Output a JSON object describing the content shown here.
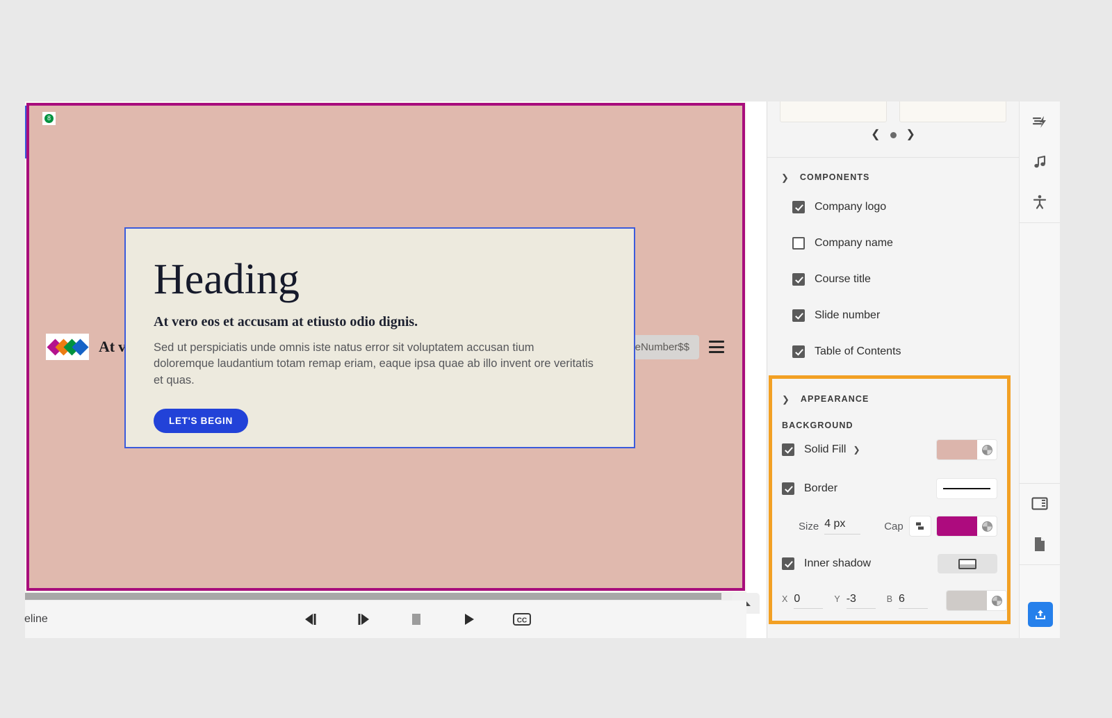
{
  "slide": {
    "header": {
      "logo_icon": "company-logo-diamonds",
      "logo_inner_label": "8",
      "course_title": "At vero eos et accusamus et iusto.",
      "slide_number_variable": "$$Project.CurrentSlideNumber$$",
      "toc_icon": "hamburger-menu-icon",
      "background_color": "#e0b9ae",
      "border_color": "#a80d7c"
    },
    "text_block": {
      "heading": "Heading",
      "subheading": "At vero eos et accusam at etiusto odio dignis.",
      "body": "Sed ut perspiciatis unde omnis iste natus error sit voluptatem accusan tium doloremque laudantium totam remap eriam, eaque ipsa quae ab illo invent ore veritatis et quas.",
      "cta_label": "LET'S BEGIN",
      "cta_color": "#2242d8",
      "background_color": "#edeade"
    }
  },
  "timeline": {
    "label": "eline",
    "controls": [
      {
        "name": "step-backward-button",
        "glyph": "prev"
      },
      {
        "name": "step-forward-button",
        "glyph": "next"
      },
      {
        "name": "stop-button",
        "glyph": "stop"
      },
      {
        "name": "play-button",
        "glyph": "play"
      },
      {
        "name": "closed-captions-button",
        "glyph": "cc",
        "label": "CC"
      }
    ],
    "collapse_icon": "chevron-up-icon"
  },
  "properties_panel": {
    "carousel": {
      "prev_icon": "chevron-left-icon",
      "next_icon": "chevron-right-icon",
      "dot_icon": "carousel-dot"
    },
    "components": {
      "title": "COMPONENTS",
      "collapse_icon": "chevron-down-icon",
      "items": [
        {
          "label": "Company logo",
          "checked": true
        },
        {
          "label": "Company name",
          "checked": false
        },
        {
          "label": "Course title",
          "checked": true
        },
        {
          "label": "Slide number",
          "checked": true
        },
        {
          "label": "Table of Contents",
          "checked": true
        }
      ]
    },
    "appearance": {
      "title": "APPEARANCE",
      "collapse_icon": "chevron-down-icon",
      "highlight_color": "#f2a024",
      "background_group_label": "BACKGROUND",
      "solid_fill": {
        "label": "Solid Fill",
        "checked": true,
        "dropdown_icon": "chevron-down-icon",
        "color": "#dcb5ac",
        "opacity_icon": "opacity-wheel-icon"
      },
      "border": {
        "label": "Border",
        "checked": true,
        "style_preview": "solid-line",
        "size_label": "Size",
        "size_value": "4 px",
        "cap_label": "Cap",
        "cap_icon": "line-cap-icon",
        "color": "#ad0b7e",
        "opacity_icon": "opacity-wheel-icon"
      },
      "inner_shadow": {
        "label": "Inner shadow",
        "checked": true,
        "preview_icon": "inner-shadow-preview-icon",
        "x_label": "X",
        "x_value": "0",
        "y_label": "Y",
        "y_value": "-3",
        "b_label": "B",
        "b_value": "6",
        "color": "#cfcbc8",
        "opacity_icon": "opacity-wheel-icon"
      }
    }
  },
  "right_rail": {
    "items": [
      {
        "name": "animation-icon",
        "group": 1
      },
      {
        "name": "audio-music-icon",
        "group": 1
      },
      {
        "name": "accessibility-icon",
        "group": 1
      },
      {
        "name": "layout-panel-icon",
        "group": 2
      },
      {
        "name": "document-icon",
        "group": 2
      }
    ],
    "publish": {
      "name": "publish-upload-button",
      "color": "#2680eb"
    }
  }
}
